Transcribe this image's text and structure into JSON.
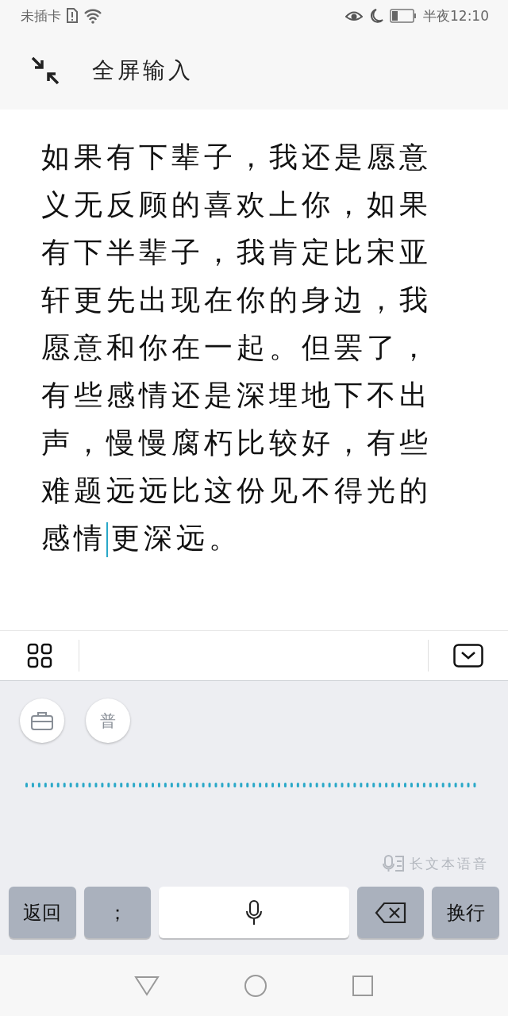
{
  "status_bar": {
    "carrier": "未插卡",
    "time": "半夜12:10"
  },
  "header": {
    "title": "全屏输入"
  },
  "editor": {
    "text_before_cursor": "如果有下辈子，我还是愿意义无反顾的喜欢上你，如果有下半辈子，我肯定比宋亚轩更先出现在你的身边，我愿意和你在一起。但罢了，有些感情还是深埋地下不出声，慢慢腐朽比较好，有些难题远远比这份见不得光的感情",
    "text_after_cursor": "更深远。"
  },
  "keyboard": {
    "mode_button": "普",
    "voice_hint": "长文本语音",
    "keys": [
      {
        "kind": "text",
        "label": "返回"
      },
      {
        "kind": "text",
        "label": "；"
      },
      {
        "kind": "mic"
      },
      {
        "kind": "backspace"
      },
      {
        "kind": "text",
        "label": "换行"
      }
    ]
  }
}
